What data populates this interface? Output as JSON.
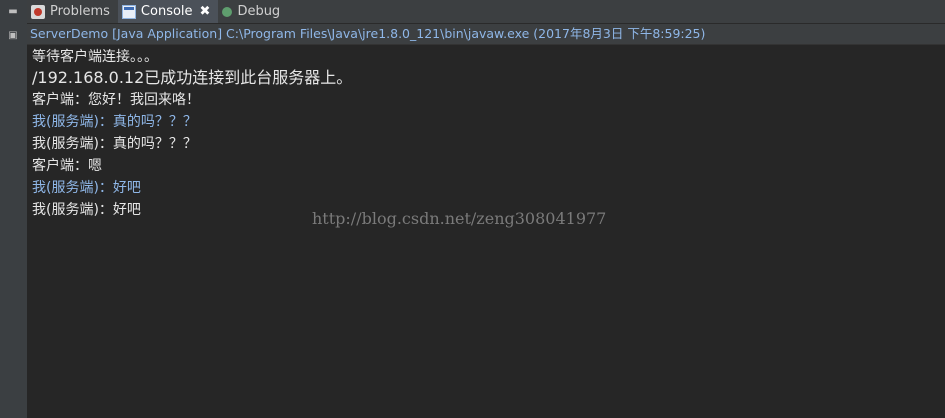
{
  "tabs": [
    {
      "label": "Problems",
      "icon": "problems-icon"
    },
    {
      "label": "Console",
      "icon": "console-icon",
      "active": true,
      "close": "✖"
    },
    {
      "label": "Debug",
      "icon": "debug-icon"
    }
  ],
  "info_line": "ServerDemo [Java Application] C:\\Program Files\\Java\\jre1.8.0_121\\bin\\javaw.exe (2017年8月3日 下午8:59:25)",
  "console_lines": [
    {
      "text": "等待客户端连接。。。",
      "kind": "output"
    },
    {
      "text": "/192.168.0.12已成功连接到此台服务器上。",
      "kind": "output-large"
    },
    {
      "text": "客户端：您好！我回来咯！",
      "kind": "output"
    },
    {
      "text": "我(服务端)：真的吗？？？",
      "kind": "input"
    },
    {
      "text": "我(服务端)：真的吗？？？",
      "kind": "output"
    },
    {
      "text": "客户端：嗯",
      "kind": "output"
    },
    {
      "text": "我(服务端)：好吧",
      "kind": "input"
    },
    {
      "text": "我(服务端)：好吧",
      "kind": "output"
    }
  ],
  "watermark": "http://blog.csdn.net/zeng308041977",
  "colors": {
    "background": "#262626",
    "output_text": "#e6e6e6",
    "input_text": "#8fb7e8",
    "info_text": "#8fb7e8"
  }
}
